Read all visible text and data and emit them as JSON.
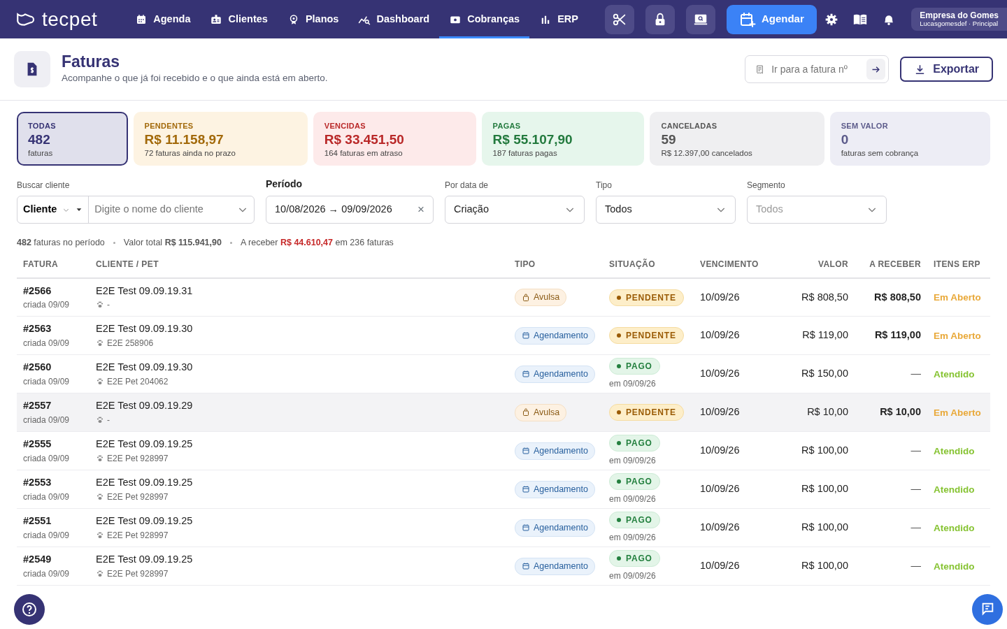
{
  "brand": "tecpet",
  "nav": [
    {
      "label": "Agenda",
      "selected": false
    },
    {
      "label": "Clientes",
      "selected": false
    },
    {
      "label": "Planos",
      "selected": false
    },
    {
      "label": "Dashboard",
      "selected": false
    },
    {
      "label": "Cobranças",
      "selected": true
    },
    {
      "label": "ERP",
      "selected": false
    }
  ],
  "schedule_button": "Agendar",
  "account": {
    "name": "Empresa do Gomes",
    "subtitle": "Lucasgomesdef · Principal"
  },
  "page": {
    "title": "Faturas",
    "subtitle": "Acompanhe o que já foi recebido e o que ainda está em aberto.",
    "goto_placeholder": "Ir para a fatura nº",
    "export": "Exportar"
  },
  "cards": [
    {
      "kind": "all",
      "label": "TODAS",
      "value": "482",
      "note": "faturas",
      "selected": true
    },
    {
      "kind": "pending",
      "label": "PENDENTES",
      "value": "R$ 11.158,97",
      "note": "72 faturas ainda no prazo",
      "selected": false
    },
    {
      "kind": "overdue",
      "label": "VENCIDAS",
      "value": "R$ 33.451,50",
      "note": "164 faturas em atraso",
      "selected": false
    },
    {
      "kind": "paid",
      "label": "PAGAS",
      "value": "R$ 55.107,90",
      "note": "187 faturas pagas",
      "selected": false
    },
    {
      "kind": "cancelled",
      "label": "CANCELADAS",
      "value": "59",
      "note": "R$ 12.397,00 cancelados",
      "selected": false
    },
    {
      "kind": "novalue",
      "label": "SEM VALOR",
      "value": "0",
      "note": "faturas sem cobrança",
      "selected": false
    }
  ],
  "filters": {
    "client": {
      "label": "Buscar cliente",
      "mode": "Cliente",
      "placeholder": "Digite o nome do cliente"
    },
    "period": {
      "label": "Período",
      "value": "10/08/2026 → 09/09/2026",
      "clear": "×"
    },
    "date_by": {
      "label": "Por data de",
      "value": "Criação"
    },
    "type": {
      "label": "Tipo",
      "value": "Todos"
    },
    "segment": {
      "label": "Segmento",
      "placeholder": "Todos"
    }
  },
  "summary": "**482** faturas no período",
  "summary_total": "Valor total **R$ 115.941,90**",
  "summary_due": {
    "prefix": "A receber",
    "amount": "R$ 44.610,47",
    "suffix": "em 236 faturas"
  },
  "table": {
    "columns": [
      "FATURA",
      "CLIENTE / PET",
      "TIPO",
      "SITUAÇÃO",
      "VENCIMENTO",
      "VALOR",
      "A RECEBER",
      "ITENS ERP"
    ],
    "rows": [
      {
        "id": "#2566",
        "created": "criada 09/09",
        "client": "E2E Test 09.09.19.31",
        "pet": "-",
        "type": {
          "kind": "avulsa",
          "label": "Avulsa"
        },
        "status": {
          "kind": "pending",
          "label": "PENDENTE"
        },
        "due": "10/09/26",
        "value": "R$ 808,50",
        "receivable": "R$ 808,50",
        "erp": {
          "kind": "open",
          "label": "Em Aberto"
        },
        "highlighted": false
      },
      {
        "id": "#2563",
        "created": "criada 09/09",
        "client": "E2E Test 09.09.19.30",
        "pet": "E2E 258906",
        "type": {
          "kind": "agendamento",
          "label": "Agendamento"
        },
        "status": {
          "kind": "pending",
          "label": "PENDENTE"
        },
        "due": "10/09/26",
        "value": "R$ 119,00",
        "receivable": "R$ 119,00",
        "erp": {
          "kind": "open",
          "label": "Em Aberto"
        },
        "highlighted": false
      },
      {
        "id": "#2560",
        "created": "criada 09/09",
        "client": "E2E Test 09.09.19.30",
        "pet": "E2E Pet 204062",
        "type": {
          "kind": "agendamento",
          "label": "Agendamento"
        },
        "status": {
          "kind": "paid",
          "label": "PAGO",
          "paid_on": "em 09/09/26"
        },
        "due": "10/09/26",
        "value": "R$ 150,00",
        "receivable": "—",
        "erp": {
          "kind": "done",
          "label": "Atendido"
        },
        "highlighted": false
      },
      {
        "id": "#2557",
        "created": "criada 09/09",
        "client": "E2E Test 09.09.19.29",
        "pet": "-",
        "type": {
          "kind": "avulsa",
          "label": "Avulsa"
        },
        "status": {
          "kind": "pending",
          "label": "PENDENTE"
        },
        "due": "10/09/26",
        "value": "R$ 10,00",
        "receivable": "R$ 10,00",
        "erp": {
          "kind": "open",
          "label": "Em Aberto"
        },
        "highlighted": true
      },
      {
        "id": "#2555",
        "created": "criada 09/09",
        "client": "E2E Test 09.09.19.25",
        "pet": "E2E Pet 928997",
        "type": {
          "kind": "agendamento",
          "label": "Agendamento"
        },
        "status": {
          "kind": "paid",
          "label": "PAGO",
          "paid_on": "em 09/09/26"
        },
        "due": "10/09/26",
        "value": "R$ 100,00",
        "receivable": "—",
        "erp": {
          "kind": "done",
          "label": "Atendido"
        },
        "highlighted": false
      },
      {
        "id": "#2553",
        "created": "criada 09/09",
        "client": "E2E Test 09.09.19.25",
        "pet": "E2E Pet 928997",
        "type": {
          "kind": "agendamento",
          "label": "Agendamento"
        },
        "status": {
          "kind": "paid",
          "label": "PAGO",
          "paid_on": "em 09/09/26"
        },
        "due": "10/09/26",
        "value": "R$ 100,00",
        "receivable": "—",
        "erp": {
          "kind": "done",
          "label": "Atendido"
        },
        "highlighted": false
      },
      {
        "id": "#2551",
        "created": "criada 09/09",
        "client": "E2E Test 09.09.19.25",
        "pet": "E2E Pet 928997",
        "type": {
          "kind": "agendamento",
          "label": "Agendamento"
        },
        "status": {
          "kind": "paid",
          "label": "PAGO",
          "paid_on": "em 09/09/26"
        },
        "due": "10/09/26",
        "value": "R$ 100,00",
        "receivable": "—",
        "erp": {
          "kind": "done",
          "label": "Atendido"
        },
        "highlighted": false
      },
      {
        "id": "#2549",
        "created": "criada 09/09",
        "client": "E2E Test 09.09.19.25",
        "pet": "E2E Pet 928997",
        "type": {
          "kind": "agendamento",
          "label": "Agendamento"
        },
        "status": {
          "kind": "paid",
          "label": "PAGO",
          "paid_on": "em 09/09/26"
        },
        "due": "10/09/26",
        "value": "R$ 100,00",
        "receivable": "—",
        "erp": {
          "kind": "done",
          "label": "Atendido"
        },
        "highlighted": false
      }
    ]
  }
}
